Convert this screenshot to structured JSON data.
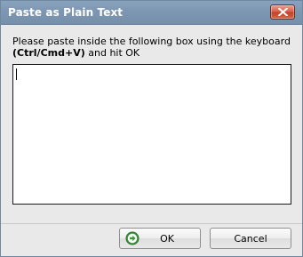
{
  "window": {
    "title": "Paste as Plain Text",
    "close_icon": "close-x-icon"
  },
  "instructions": {
    "line1": "Please paste inside the following box using the keyboard",
    "shortcut": "(Ctrl/Cmd+V)",
    "line2_rest": " and hit OK"
  },
  "paste_box": {
    "value": ""
  },
  "buttons": {
    "ok_label": "OK",
    "ok_icon": "green-arrow-right-icon",
    "cancel_label": "Cancel"
  },
  "colors": {
    "titlebar": "#7d97b2",
    "close_button": "#d9624a",
    "ok_icon_green": "#3c9a3c",
    "dialog_bg": "#e9e9e9"
  }
}
